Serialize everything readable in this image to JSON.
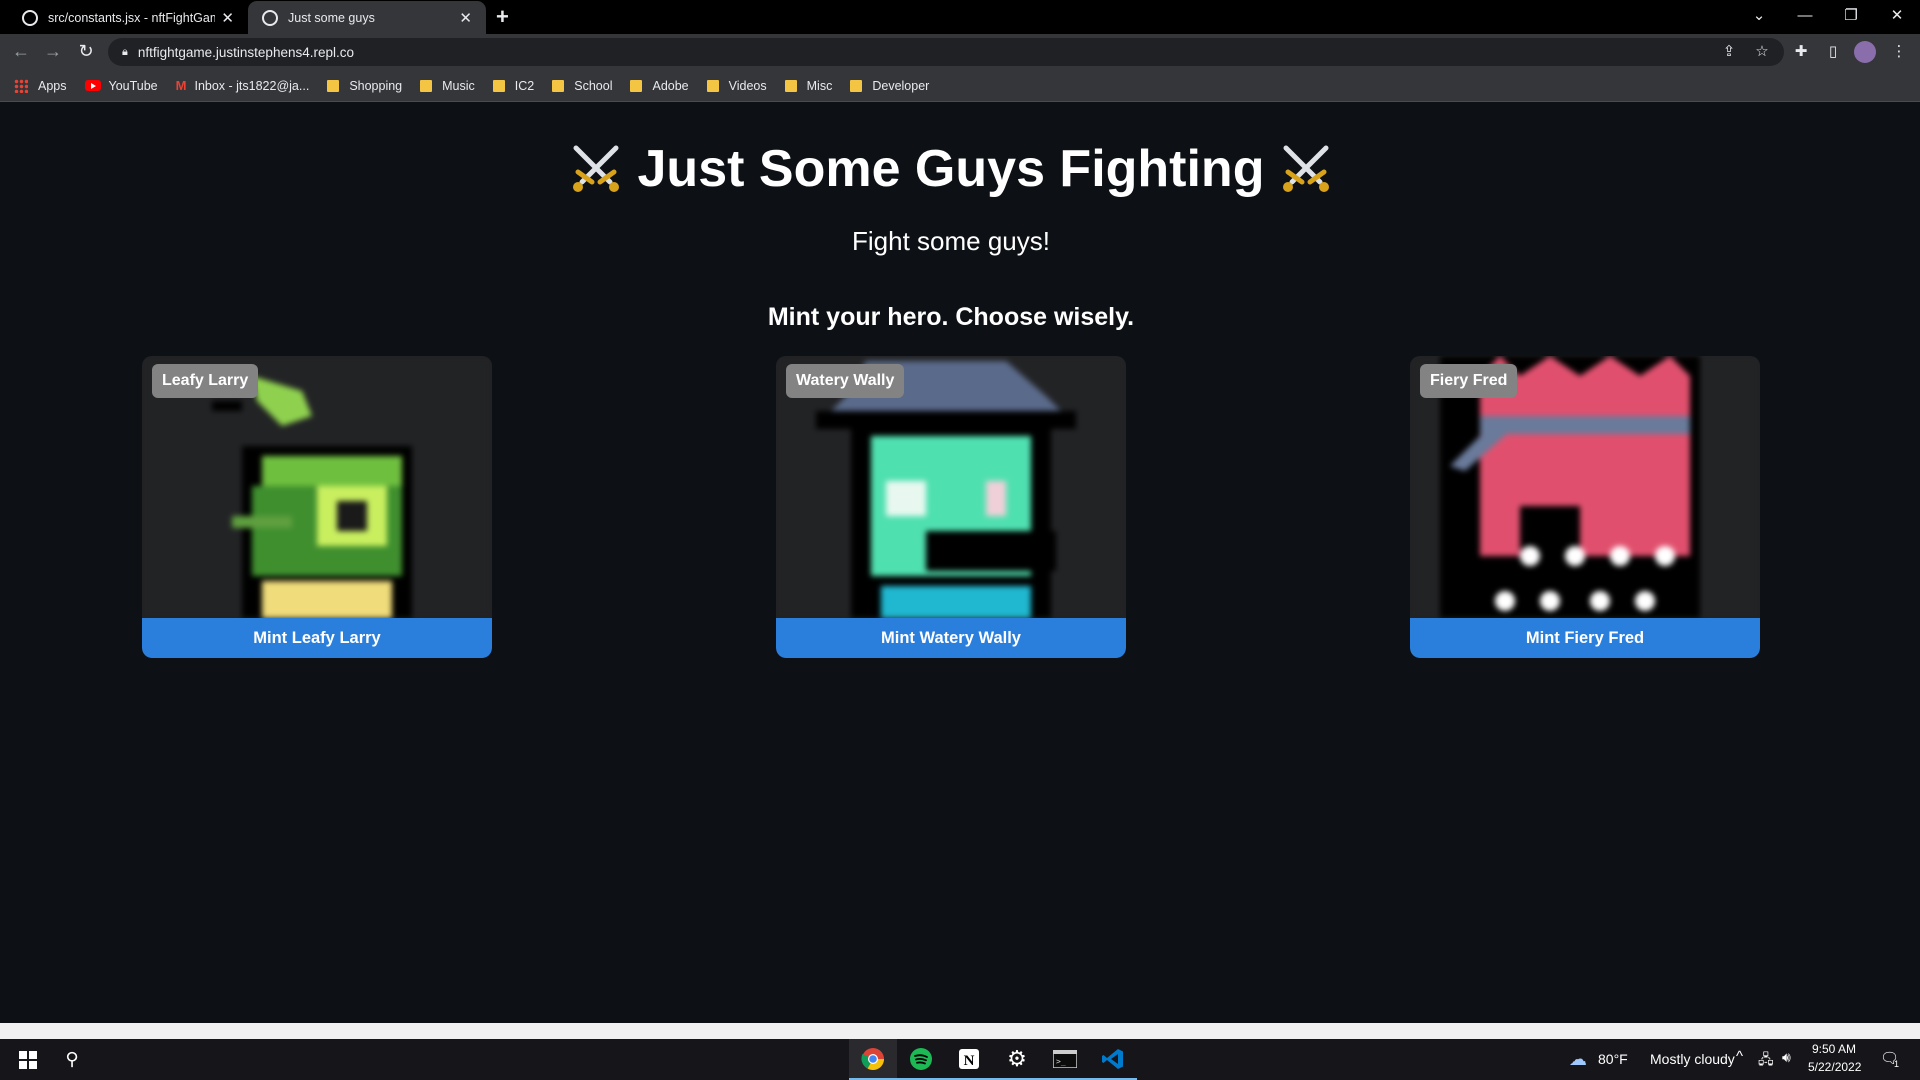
{
  "browser": {
    "tabs": [
      {
        "title": "src/constants.jsx - nftFightGame",
        "active": false
      },
      {
        "title": "Just some guys",
        "active": true
      }
    ],
    "new_tab": "+",
    "address": "nftfightgame.justinstephens4.repl.co",
    "bookmarks": [
      {
        "label": "Apps",
        "icon": "apps-grid-icon"
      },
      {
        "label": "YouTube",
        "icon": "youtube-icon"
      },
      {
        "label": "Inbox - jts1822@ja...",
        "icon": "gmail-icon"
      },
      {
        "label": "Shopping",
        "icon": "folder-icon"
      },
      {
        "label": "Music",
        "icon": "folder-icon"
      },
      {
        "label": "IC2",
        "icon": "folder-icon"
      },
      {
        "label": "School",
        "icon": "folder-icon"
      },
      {
        "label": "Adobe",
        "icon": "folder-icon"
      },
      {
        "label": "Videos",
        "icon": "folder-icon"
      },
      {
        "label": "Misc",
        "icon": "folder-icon"
      },
      {
        "label": "Developer",
        "icon": "folder-icon"
      }
    ]
  },
  "page": {
    "title": "Just Some Guys Fighting",
    "subtitle": "Fight some guys!",
    "heading": "Mint your hero. Choose wisely.",
    "characters": [
      {
        "name": "Leafy Larry",
        "mint_label": "Mint Leafy Larry",
        "theme": "#7ed957"
      },
      {
        "name": "Watery Wally",
        "mint_label": "Mint Watery Wally",
        "theme": "#4fe0b0"
      },
      {
        "name": "Fiery Fred",
        "mint_label": "Mint Fiery Fred",
        "theme": "#e0506e"
      }
    ],
    "accent_color": "#2a7fdd",
    "background_color": "#0d1116"
  },
  "taskbar": {
    "weather": {
      "temp": "80°F",
      "condition": "Mostly cloudy"
    },
    "time": "9:50 AM",
    "date": "5/22/2022",
    "notifications": "1"
  }
}
